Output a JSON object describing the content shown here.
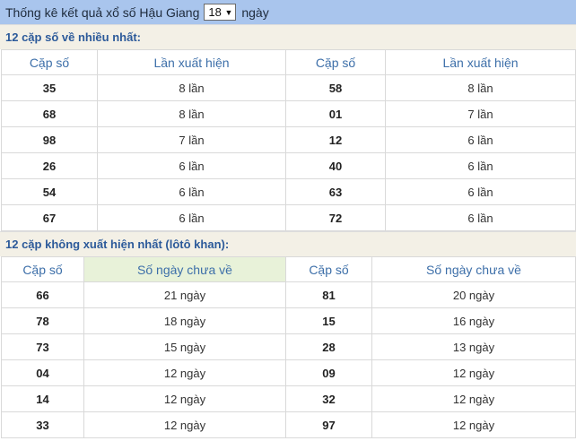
{
  "header": {
    "title": "Thống kê kết quả xổ số Hậu Giang",
    "days_selected": "18",
    "suffix": "ngày"
  },
  "section1": {
    "title": "12 cặp số về nhiều nhất:",
    "col_pair": "Cặp số",
    "col_count": "Lần xuất hiện",
    "rows": [
      {
        "a_pair": "35",
        "a_val": "8 lần",
        "b_pair": "58",
        "b_val": "8 lần"
      },
      {
        "a_pair": "68",
        "a_val": "8 lần",
        "b_pair": "01",
        "b_val": "7 lần"
      },
      {
        "a_pair": "98",
        "a_val": "7 lần",
        "b_pair": "12",
        "b_val": "6 lần"
      },
      {
        "a_pair": "26",
        "a_val": "6 lần",
        "b_pair": "40",
        "b_val": "6 lần"
      },
      {
        "a_pair": "54",
        "a_val": "6 lần",
        "b_pair": "63",
        "b_val": "6 lần"
      },
      {
        "a_pair": "67",
        "a_val": "6 lần",
        "b_pair": "72",
        "b_val": "6 lần"
      }
    ]
  },
  "section2": {
    "title": "12 cặp không xuất hiện nhất (lôtô khan):",
    "col_pair": "Cặp số",
    "col_days": "Số ngày chưa về",
    "rows": [
      {
        "a_pair": "66",
        "a_val": "21 ngày",
        "b_pair": "81",
        "b_val": "20 ngày"
      },
      {
        "a_pair": "78",
        "a_val": "18 ngày",
        "b_pair": "15",
        "b_val": "16 ngày"
      },
      {
        "a_pair": "73",
        "a_val": "15 ngày",
        "b_pair": "28",
        "b_val": "13 ngày"
      },
      {
        "a_pair": "04",
        "a_val": "12 ngày",
        "b_pair": "09",
        "b_val": "12 ngày"
      },
      {
        "a_pair": "14",
        "a_val": "12 ngày",
        "b_pair": "32",
        "b_val": "12 ngày"
      },
      {
        "a_pair": "33",
        "a_val": "12 ngày",
        "b_pair": "97",
        "b_val": "12 ngày"
      }
    ]
  }
}
